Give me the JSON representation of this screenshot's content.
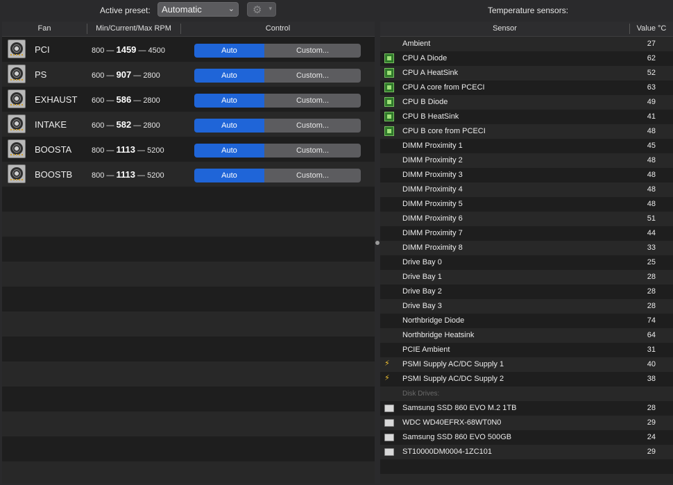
{
  "toolbar": {
    "preset_label": "Active preset:",
    "preset_value": "Automatic",
    "temp_title": "Temperature sensors:"
  },
  "fans_table": {
    "headers": {
      "fan": "Fan",
      "rpm": "Min/Current/Max RPM",
      "control": "Control"
    },
    "rows": [
      {
        "name": "PCI",
        "min": "800",
        "current": "1459",
        "max": "4500",
        "auto": "Auto",
        "custom": "Custom..."
      },
      {
        "name": "PS",
        "min": "600",
        "current": "907",
        "max": "2800",
        "auto": "Auto",
        "custom": "Custom..."
      },
      {
        "name": "EXHAUST",
        "min": "600",
        "current": "586",
        "max": "2800",
        "auto": "Auto",
        "custom": "Custom..."
      },
      {
        "name": "INTAKE",
        "min": "600",
        "current": "582",
        "max": "2800",
        "auto": "Auto",
        "custom": "Custom..."
      },
      {
        "name": "BOOSTA",
        "min": "800",
        "current": "1113",
        "max": "5200",
        "auto": "Auto",
        "custom": "Custom..."
      },
      {
        "name": "BOOSTB",
        "min": "800",
        "current": "1113",
        "max": "5200",
        "auto": "Auto",
        "custom": "Custom..."
      }
    ],
    "dash": "—"
  },
  "sensors_table": {
    "headers": {
      "sensor": "Sensor",
      "value": "Value °C"
    },
    "rows": [
      {
        "icon": "none",
        "name": "Ambient",
        "value": "27"
      },
      {
        "icon": "chip",
        "name": "CPU A Diode",
        "value": "62"
      },
      {
        "icon": "chip",
        "name": "CPU A HeatSink",
        "value": "52"
      },
      {
        "icon": "chip",
        "name": "CPU A core from PCECI",
        "value": "63"
      },
      {
        "icon": "chip",
        "name": "CPU B Diode",
        "value": "49"
      },
      {
        "icon": "chip",
        "name": "CPU B HeatSink",
        "value": "41"
      },
      {
        "icon": "chip",
        "name": "CPU B core from PCECI",
        "value": "48"
      },
      {
        "icon": "none",
        "name": "DIMM Proximity 1",
        "value": "45"
      },
      {
        "icon": "none",
        "name": "DIMM Proximity 2",
        "value": "48"
      },
      {
        "icon": "none",
        "name": "DIMM Proximity 3",
        "value": "48"
      },
      {
        "icon": "none",
        "name": "DIMM Proximity 4",
        "value": "48"
      },
      {
        "icon": "none",
        "name": "DIMM Proximity 5",
        "value": "48"
      },
      {
        "icon": "none",
        "name": "DIMM Proximity 6",
        "value": "51"
      },
      {
        "icon": "none",
        "name": "DIMM Proximity 7",
        "value": "44"
      },
      {
        "icon": "none",
        "name": "DIMM Proximity 8",
        "value": "33"
      },
      {
        "icon": "none",
        "name": "Drive Bay 0",
        "value": "25"
      },
      {
        "icon": "none",
        "name": "Drive Bay 1",
        "value": "28"
      },
      {
        "icon": "none",
        "name": "Drive Bay 2",
        "value": "28"
      },
      {
        "icon": "none",
        "name": "Drive Bay 3",
        "value": "28"
      },
      {
        "icon": "none",
        "name": "Northbridge Diode",
        "value": "74"
      },
      {
        "icon": "none",
        "name": "Northbridge Heatsink",
        "value": "64"
      },
      {
        "icon": "none",
        "name": "PCIE Ambient",
        "value": "31"
      },
      {
        "icon": "bolt",
        "name": "PSMI Supply AC/DC Supply 1",
        "value": "40"
      },
      {
        "icon": "bolt",
        "name": "PSMI Supply AC/DC Supply 2",
        "value": "38"
      }
    ],
    "disk_section_label": "Disk Drives:",
    "disks": [
      {
        "icon": "disk",
        "name": "Samsung SSD 860 EVO M.2 1TB",
        "value": "28"
      },
      {
        "icon": "disk",
        "name": "WDC WD40EFRX-68WT0N0",
        "value": "29"
      },
      {
        "icon": "disk",
        "name": "Samsung SSD 860 EVO 500GB",
        "value": "24"
      },
      {
        "icon": "disk",
        "name": "ST10000DM0004-1ZC101",
        "value": "29"
      }
    ]
  },
  "colors": {
    "accent": "#1f65d8",
    "row_alt": "#282828",
    "row": "#1e1e1e"
  }
}
